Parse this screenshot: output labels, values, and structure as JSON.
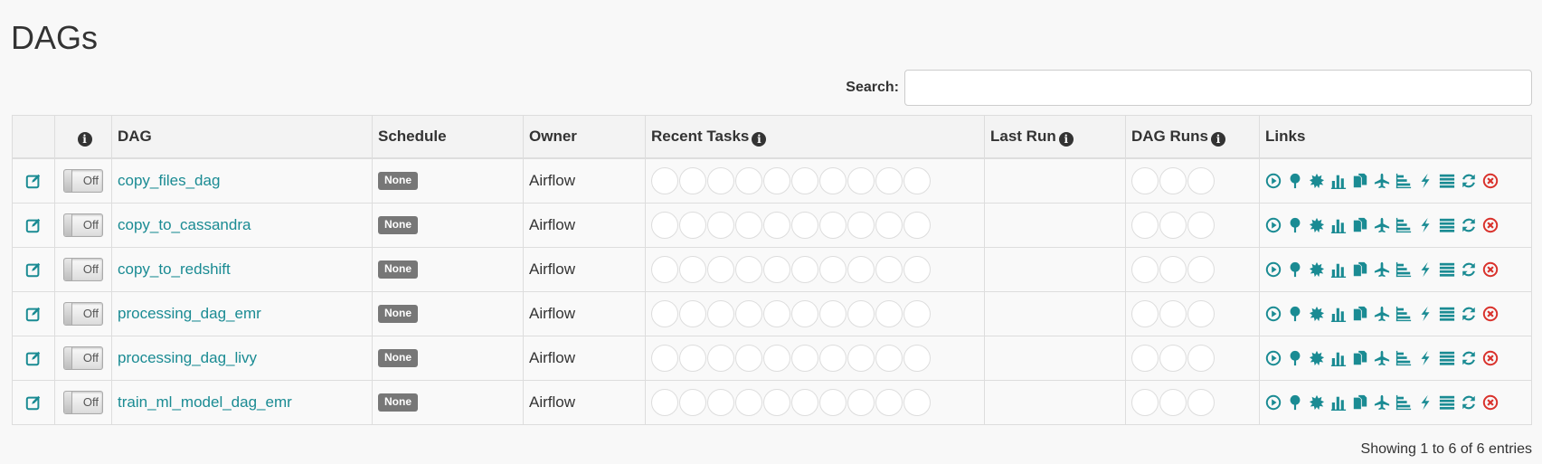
{
  "page": {
    "title": "DAGs"
  },
  "search": {
    "label": "Search:",
    "value": "",
    "placeholder": ""
  },
  "table": {
    "columns": {
      "dag": "DAG",
      "schedule": "Schedule",
      "owner": "Owner",
      "recent_tasks": "Recent Tasks",
      "last_run": "Last Run",
      "dag_runs": "DAG Runs",
      "links": "Links"
    },
    "rows": [
      {
        "toggle": "Off",
        "dag": "copy_files_dag",
        "schedule": "None",
        "owner": "Airflow",
        "last_run": ""
      },
      {
        "toggle": "Off",
        "dag": "copy_to_cassandra",
        "schedule": "None",
        "owner": "Airflow",
        "last_run": ""
      },
      {
        "toggle": "Off",
        "dag": "copy_to_redshift",
        "schedule": "None",
        "owner": "Airflow",
        "last_run": ""
      },
      {
        "toggle": "Off",
        "dag": "processing_dag_emr",
        "schedule": "None",
        "owner": "Airflow",
        "last_run": ""
      },
      {
        "toggle": "Off",
        "dag": "processing_dag_livy",
        "schedule": "None",
        "owner": "Airflow",
        "last_run": ""
      },
      {
        "toggle": "Off",
        "dag": "train_ml_model_dag_emr",
        "schedule": "None",
        "owner": "Airflow",
        "last_run": ""
      }
    ],
    "recent_task_circle_count": 10,
    "dag_run_circle_count": 3,
    "link_icons": [
      "trigger-dag-icon",
      "tree-view-icon",
      "graph-view-icon",
      "tries-chart-icon",
      "landing-times-icon",
      "gantt-icon",
      "code-icon",
      "details-icon",
      "logs-icon",
      "refresh-icon",
      "delete-dag-icon"
    ]
  },
  "footer": {
    "entries_text": "Showing 1 to 6 of 6 entries"
  },
  "colors": {
    "accent": "#1a8b93",
    "delete": "#d9322c",
    "badge": "#777777"
  }
}
